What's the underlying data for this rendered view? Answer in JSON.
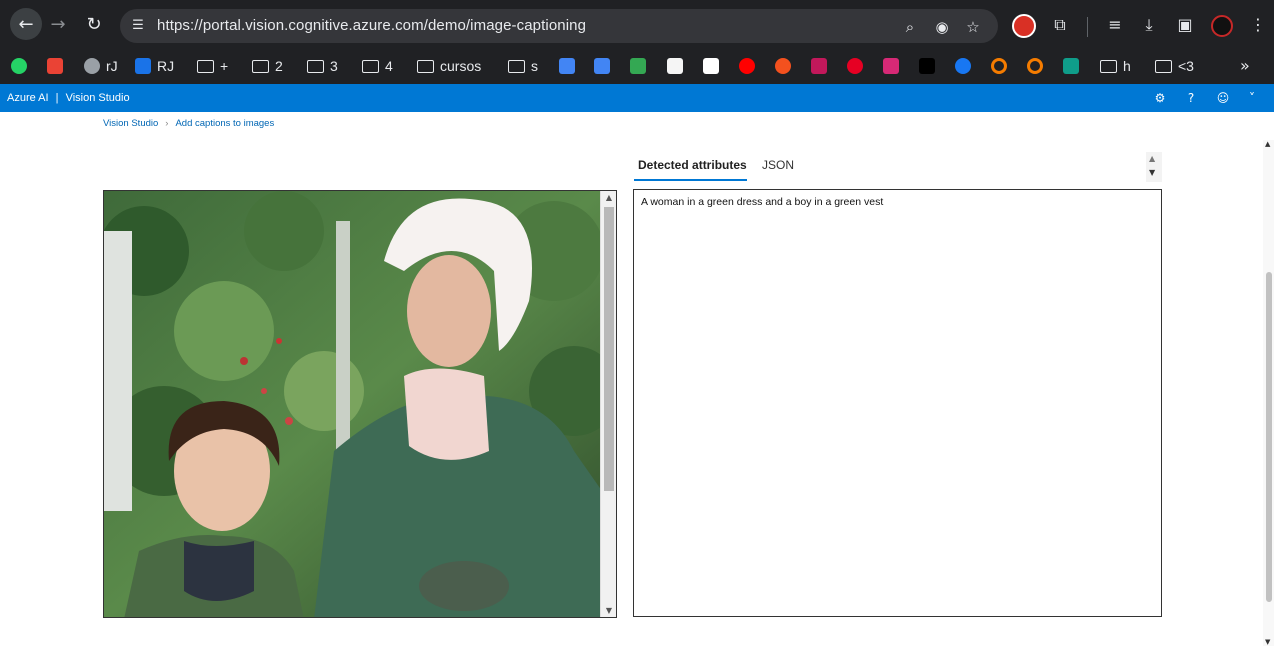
{
  "browser": {
    "url": "https://portal.vision.cognitive.azure.com/demo/image-captioning",
    "icons": [
      "back-icon",
      "forward-icon",
      "reload-icon",
      "site-info-icon",
      "zoom-icon",
      "eye-off-icon",
      "star-icon",
      "adblock-icon",
      "extensions-icon",
      "media-icon",
      "download-icon",
      "sidepanel-icon",
      "profile-avatar",
      "menu-icon"
    ]
  },
  "bookmarks": [
    {
      "label": "",
      "icon": "whatsapp-icon",
      "color": "#25d366"
    },
    {
      "label": "",
      "icon": "gmail-icon",
      "color": "#ea4335"
    },
    {
      "label": "rJ",
      "icon": "globe-icon",
      "color": "#9aa0a6"
    },
    {
      "label": "RJ",
      "icon": "translate-icon",
      "color": "#1a73e8"
    },
    {
      "label": "+",
      "icon": "folder-icon"
    },
    {
      "label": "2",
      "icon": "folder-icon"
    },
    {
      "label": "3",
      "icon": "folder-icon"
    },
    {
      "label": "4",
      "icon": "folder-icon"
    },
    {
      "label": "cursos",
      "icon": "folder-icon"
    },
    {
      "label": "s",
      "icon": "folder-icon"
    },
    {
      "label": "",
      "icon": "calendar-icon",
      "color": "#4285f4"
    },
    {
      "label": "",
      "icon": "google-translate-icon",
      "color": "#4285f4"
    },
    {
      "label": "",
      "icon": "assistant-icon",
      "color": "#34a853"
    },
    {
      "label": "",
      "icon": "k-icon",
      "color": "#f5f5f5"
    },
    {
      "label": "",
      "icon": "amazon-icon",
      "color": "#ffffff"
    },
    {
      "label": "",
      "icon": "youtube-music-icon",
      "color": "#ff0000"
    },
    {
      "label": "",
      "icon": "orange-icon",
      "color": "#f4511e"
    },
    {
      "label": "",
      "icon": "feather-icon",
      "color": "#c2185b"
    },
    {
      "label": "",
      "icon": "pinterest-icon",
      "color": "#e60023"
    },
    {
      "label": "",
      "icon": "instagram-icon",
      "color": "#d62976"
    },
    {
      "label": "",
      "icon": "x-icon",
      "color": "#000000"
    },
    {
      "label": "",
      "icon": "facebook-icon",
      "color": "#1877f2"
    },
    {
      "label": "",
      "icon": "ring-icon",
      "color": "#f57c00"
    },
    {
      "label": "",
      "icon": "ring-icon",
      "color": "#f57c00"
    },
    {
      "label": "",
      "icon": "edge-icon",
      "color": "#0f9d8a"
    },
    {
      "label": "h",
      "icon": "folder-icon"
    },
    {
      "label": "<3",
      "icon": "folder-icon"
    }
  ],
  "azure": {
    "brand": "Azure AI",
    "divider": "|",
    "product": "Vision Studio",
    "header_icons": [
      "settings-icon",
      "help-icon",
      "feedback-icon",
      "account-icon"
    ]
  },
  "breadcrumb": {
    "root": "Vision Studio",
    "current": "Add captions to images"
  },
  "tabs": [
    {
      "label": "Detected attributes",
      "active": true
    },
    {
      "label": "JSON",
      "active": false
    }
  ],
  "result": {
    "caption": "A woman in a green dress and a boy in a green vest"
  },
  "colors": {
    "azure_blue": "#0078d4",
    "chrome_dark": "#202124",
    "link_blue": "#0066b4"
  }
}
